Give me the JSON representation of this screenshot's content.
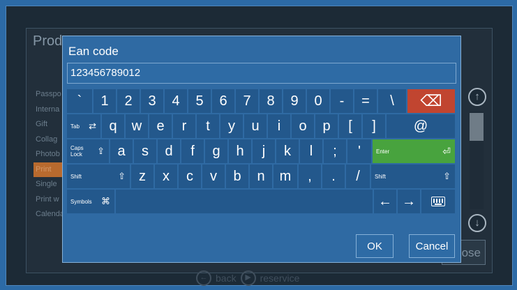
{
  "background": {
    "title": "Prod",
    "list_items": [
      "Passpo",
      "Interna",
      "Gift",
      "Collag",
      "Photob",
      "Print",
      "Single",
      "Print w",
      "Calenda"
    ],
    "selected_index": 5,
    "close_label": "lose",
    "nav": {
      "back_label": "back",
      "service_label": "reservice"
    }
  },
  "dialog": {
    "title": "Ean code",
    "value": "123456789012",
    "ok_label": "OK",
    "cancel_label": "Cancel"
  },
  "keyboard": {
    "row1": [
      "`",
      "1",
      "2",
      "3",
      "4",
      "5",
      "6",
      "7",
      "8",
      "9",
      "0",
      "-",
      "=",
      "\\"
    ],
    "backspace_glyph": "⌫",
    "tab_label": "Tab",
    "tab_glyph": "⇄",
    "row2": [
      "q",
      "w",
      "e",
      "r",
      "t",
      "y",
      "u",
      "i",
      "o",
      "p",
      "[",
      "]"
    ],
    "at_key": "@",
    "caps_label": "Caps Lock",
    "caps_glyph": "⇪",
    "row3": [
      "a",
      "s",
      "d",
      "f",
      "g",
      "h",
      "j",
      "k",
      "l",
      ";",
      "'"
    ],
    "enter_label": "Enter",
    "enter_glyph": "⏎",
    "shift_label": "Shift",
    "shift_glyph": "⇧",
    "row4": [
      "z",
      "x",
      "c",
      "v",
      "b",
      "n",
      "m",
      ",",
      ".",
      "/"
    ],
    "symbols_label": "Symbols",
    "symbols_glyph": "⌘",
    "left_arrow": "←",
    "right_arrow": "→"
  },
  "colors": {
    "key": "#23588c",
    "backspace": "#c14530",
    "enter": "#48a33e",
    "dialog": "#2f6aa3"
  }
}
